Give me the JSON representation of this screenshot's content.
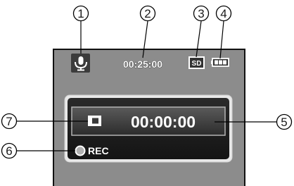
{
  "status_bar": {
    "elapsed_time": "00:25:00",
    "storage_label": "SD",
    "mic_icon": "microphone-icon",
    "battery_icon": "battery-full-icon"
  },
  "recording_panel": {
    "timer": "00:00:00",
    "stop_icon": "stop-square-icon",
    "rec_label": "REC",
    "rec_indicator_icon": "record-dot-icon"
  },
  "callouts": [
    {
      "number": "1",
      "target": "microphone-icon"
    },
    {
      "number": "2",
      "target": "elapsed-time"
    },
    {
      "number": "3",
      "target": "sd-card-icon"
    },
    {
      "number": "4",
      "target": "battery-icon"
    },
    {
      "number": "5",
      "target": "recording-timer"
    },
    {
      "number": "6",
      "target": "rec-indicator"
    },
    {
      "number": "7",
      "target": "stop-icon"
    }
  ],
  "colors": {
    "screen_bg": "#8c8c8c",
    "panel_bg": "#1e1e1e",
    "icon_bg": "#3c3c3c",
    "line": "#000000"
  }
}
